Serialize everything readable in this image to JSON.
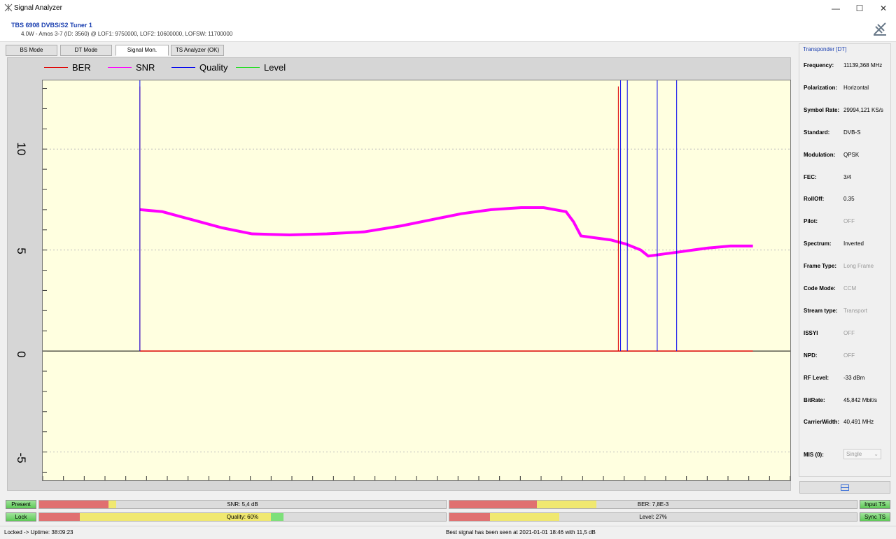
{
  "window": {
    "title": "Signal Analyzer",
    "minimize": "—",
    "maximize": "☐",
    "close": "✕"
  },
  "header": {
    "device": "TBS 6908 DVBS/S2 Tuner 1",
    "satellite": "4.0W - Amos 3-7 (ID: 3560) @ LOF1: 9750000, LOF2: 10600000, LOFSW: 11700000"
  },
  "tabs": [
    {
      "label": "BS Mode"
    },
    {
      "label": "DT Mode"
    },
    {
      "label": "Signal Mon."
    },
    {
      "label": "TS Analyzer (OK)"
    }
  ],
  "chart_data": {
    "type": "line",
    "legend": [
      {
        "name": "BER",
        "color": "#e00000"
      },
      {
        "name": "SNR",
        "color": "#ff00ff"
      },
      {
        "name": "Quality",
        "color": "#0000ee"
      },
      {
        "name": "Level",
        "color": "#22dd22"
      }
    ],
    "yticks": [
      "10",
      "5",
      "0",
      "-5"
    ],
    "ylim": [
      -6.4,
      13.4
    ],
    "xlim": [
      0,
      1000
    ],
    "grid": true,
    "legend_position": "top",
    "series": [
      {
        "name": "SNR",
        "x": [
          130,
          160,
          200,
          240,
          280,
          330,
          380,
          430,
          480,
          520,
          560,
          600,
          640,
          670,
          700,
          710,
          720,
          740,
          760,
          780,
          800,
          810,
          830,
          850,
          870,
          890,
          920,
          950
        ],
        "values": [
          7.0,
          6.9,
          6.5,
          6.1,
          5.8,
          5.75,
          5.8,
          5.9,
          6.2,
          6.5,
          6.8,
          7.0,
          7.1,
          7.1,
          6.9,
          6.4,
          5.7,
          5.6,
          5.5,
          5.3,
          5.0,
          4.7,
          4.8,
          4.9,
          5.0,
          5.1,
          5.2,
          5.2
        ]
      },
      {
        "name": "BER",
        "x": [
          130,
          950
        ],
        "values": [
          0,
          0
        ]
      },
      {
        "name": "Quality",
        "x": [
          130,
          773,
          780,
          820,
          845
        ],
        "values": [
          13.4,
          13.4,
          13.4,
          13.4,
          13.4
        ]
      }
    ],
    "spikes": [
      {
        "series": "BER",
        "x": 130
      },
      {
        "series": "BER",
        "x": 770
      },
      {
        "series": "Quality",
        "x": 130
      },
      {
        "series": "Quality",
        "x": 773
      },
      {
        "series": "Quality",
        "x": 782
      },
      {
        "series": "Quality",
        "x": 822
      },
      {
        "series": "Quality",
        "x": 848
      }
    ]
  },
  "transponder": {
    "heading": "Transponder [DT]",
    "fields": [
      {
        "key": "Frequency:",
        "value": "11139,368 MHz",
        "dim": false
      },
      {
        "key": "Polarization:",
        "value": "Horizontal",
        "dim": false
      },
      {
        "key": "Symbol Rate:",
        "value": "29994,121 KS/s",
        "dim": false
      },
      {
        "key": "Standard:",
        "value": "DVB-S",
        "dim": false
      },
      {
        "key": "Modulation:",
        "value": "QPSK",
        "dim": false
      },
      {
        "key": "FEC:",
        "value": "3/4",
        "dim": false
      },
      {
        "key": "RollOff:",
        "value": "0.35",
        "dim": false
      },
      {
        "key": "Pilot:",
        "value": "OFF",
        "dim": true
      },
      {
        "key": "Spectrum:",
        "value": "Inverted",
        "dim": false
      },
      {
        "key": "Frame Type:",
        "value": "Long Frame",
        "dim": true
      },
      {
        "key": "Code Mode:",
        "value": "CCM",
        "dim": true
      },
      {
        "key": "Stream type:",
        "value": "Transport",
        "dim": true
      },
      {
        "key": "ISSYI",
        "value": "OFF",
        "dim": true
      },
      {
        "key": "NPD:",
        "value": "OFF",
        "dim": true
      },
      {
        "key": "RF Level:",
        "value": "-33 dBm",
        "dim": false
      },
      {
        "key": "BitRate:",
        "value": "45,842 Mbit/s",
        "dim": false
      },
      {
        "key": "CarrierWidth:",
        "value": "40,491 MHz",
        "dim": false
      }
    ],
    "mis_label": "MIS (0):",
    "mis_value": "Single"
  },
  "status": {
    "present": "Present",
    "lock": "Lock",
    "input_ts": "Input TS",
    "sync_ts": "Sync TS",
    "snr": {
      "text": "SNR: 5,4 dB",
      "fill": 0.18
    },
    "ber": {
      "text": "BER: 7,8E-3",
      "fill": 0.36
    },
    "quality": {
      "text": "Quality: 60%",
      "fill": 0.6
    },
    "level": {
      "text": "Level: 27%",
      "fill": 0.27
    }
  },
  "statusbar": {
    "left": "Locked -> Uptime: 38:09:23",
    "center": "Best signal has been seen at 2021-01-01 18:46 with 11,5 dB"
  }
}
